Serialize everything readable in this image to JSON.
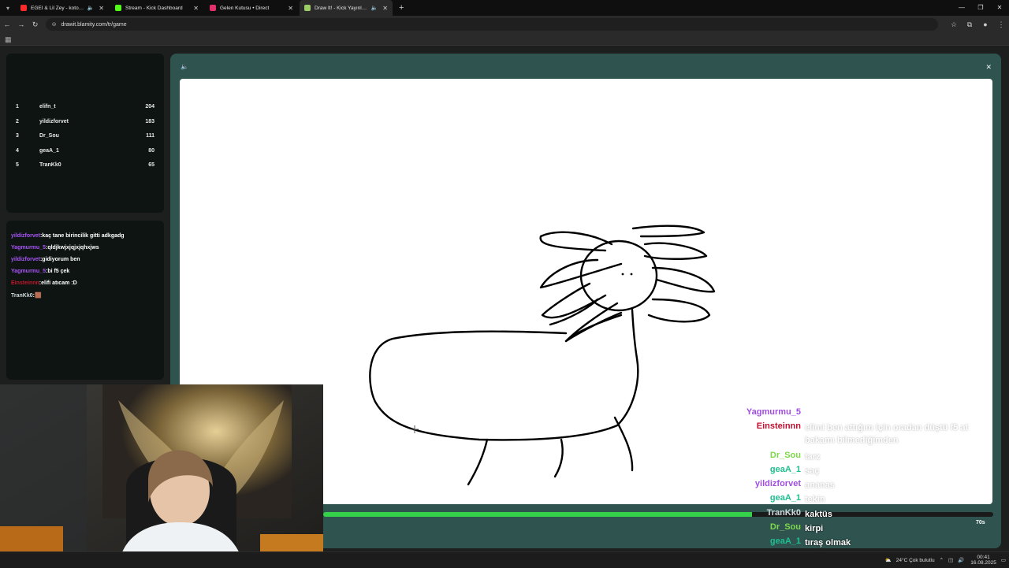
{
  "browser": {
    "tabs": [
      {
        "title": "EGEI & Lil Zey - kotojenik",
        "favicon_color": "#ff2a2a",
        "audio": true
      },
      {
        "title": "Stream - Kick Dashboard",
        "favicon_color": "#53fc18",
        "audio": false
      },
      {
        "title": "Gelen Kutusu • Direct",
        "favicon_color": "#e1306c",
        "audio": false
      },
      {
        "title": "Draw It! - Kick Yayınları İçin",
        "favicon_color": "#9ccc65",
        "audio": true,
        "active": true
      }
    ],
    "url": "drawit.blamity.com/tr/game"
  },
  "leaderboard": [
    {
      "rank": "1",
      "name": "elifn_t",
      "score": "204"
    },
    {
      "rank": "2",
      "name": "yildizforvet",
      "score": "183"
    },
    {
      "rank": "3",
      "name": "Dr_Sou",
      "score": "111"
    },
    {
      "rank": "4",
      "name": "geaA_1",
      "score": "80"
    },
    {
      "rank": "5",
      "name": "TranKk0",
      "score": "65"
    }
  ],
  "sidebar_chat": [
    {
      "user": "yildizforvet",
      "color": "#a855f7",
      "text": "kaç tane birincilik gitti adkgadg"
    },
    {
      "user": "Yagmurmu_5",
      "color": "#a855f7",
      "text": "qldjkwjxjqjxjqhxjws"
    },
    {
      "user": "yildizforvet",
      "color": "#a855f7",
      "text": "gidiyorum ben"
    },
    {
      "user": "Yagmurmu_5",
      "color": "#a855f7",
      "text": "bi f5 çek"
    },
    {
      "user": "Einsteinnn",
      "color": "#c0182b",
      "text": "elifi atıcam :D"
    },
    {
      "user": "TranKk0",
      "color": "#cfd8dc",
      "text": "🟫"
    }
  ],
  "game": {
    "timer": "70s",
    "progress": 0.64
  },
  "overlay_chat": [
    {
      "user": "Yagmurmu_5",
      "color": "#a04de0",
      "text": "",
      "faded": false
    },
    {
      "user": "Einsteinnn",
      "color": "#c01030",
      "text": "elimi ben attığım için oradan düştü f5 at bakamı bilmediğimden",
      "faded": true
    },
    {
      "user": "Dr_Sou",
      "color": "#7cd84a",
      "text": "tarz",
      "faded": true
    },
    {
      "user": "geaA_1",
      "color": "#1fbf8f",
      "text": "saç",
      "faded": true
    },
    {
      "user": "yildizforvet",
      "color": "#a04de0",
      "text": "ananas",
      "faded": true
    },
    {
      "user": "geaA_1",
      "color": "#1fbf8f",
      "text": "tekin",
      "faded": true
    },
    {
      "user": "TranKk0",
      "color": "#d0d8dc",
      "text": "kaktüs",
      "faded": false
    },
    {
      "user": "Dr_Sou",
      "color": "#7cd84a",
      "text": "kirpi",
      "faded": false
    },
    {
      "user": "geaA_1",
      "color": "#1fbf8f",
      "text": "tıraş olmak",
      "faded": false
    }
  ],
  "taskbar": {
    "weather": "24°C  Çok bulutlu",
    "time": "00:41",
    "date": "16.08.2025"
  }
}
